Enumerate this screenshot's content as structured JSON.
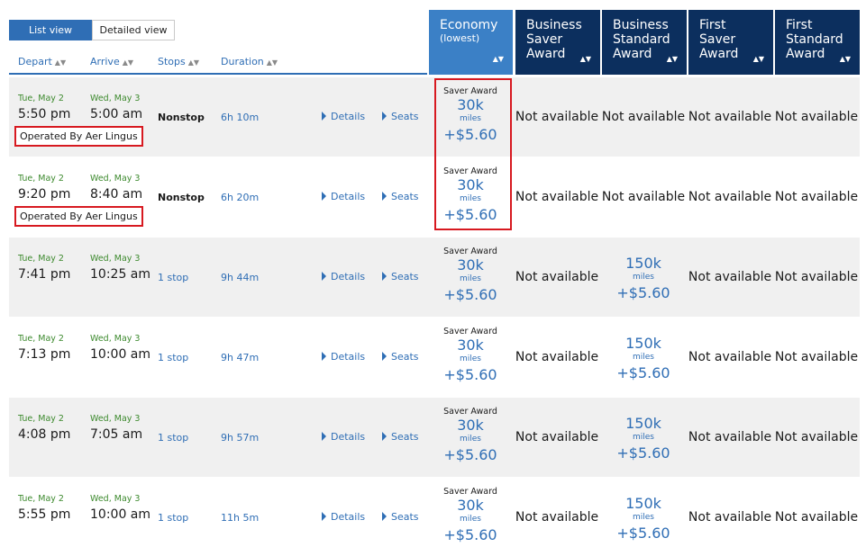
{
  "view_toggle": {
    "list": "List view",
    "detailed": "Detailed view"
  },
  "columns": {
    "depart": "Depart",
    "arrive": "Arrive",
    "stops": "Stops",
    "duration": "Duration"
  },
  "fare_headers": [
    {
      "title": "Economy",
      "sub": "(lowest)"
    },
    {
      "title": "Business Saver Award",
      "sub": ""
    },
    {
      "title": "Business Standard Award",
      "sub": ""
    },
    {
      "title": "First Saver Award",
      "sub": ""
    },
    {
      "title": "First Standard Award",
      "sub": ""
    }
  ],
  "sort_icon": "sort-arrows-icon",
  "colors": {
    "economy_header": "#3b80c6",
    "premium_header": "#0c2f5e",
    "link": "#2f6eb5",
    "date_green": "#3d8a2e",
    "highlight_red": "#d71920",
    "row_shade": "#f0f0f0"
  },
  "common": {
    "details": "Details",
    "seats": "Seats",
    "not_available": "Not available",
    "saver_award": "Saver Award",
    "miles_unit": "miles"
  },
  "flights": [
    {
      "dep_date": "Tue, May 2",
      "dep_time": "5:50 pm",
      "arr_date": "Wed, May 3",
      "arr_time": "5:00 am",
      "stops": "Nonstop",
      "duration": "6h 10m",
      "operated": "Operated By Aer Lingus",
      "econ_miles": "30k",
      "econ_tax": "+$5.60",
      "bus_std_miles": "",
      "bus_std_tax": ""
    },
    {
      "dep_date": "Tue, May 2",
      "dep_time": "9:20 pm",
      "arr_date": "Wed, May 3",
      "arr_time": "8:40 am",
      "stops": "Nonstop",
      "duration": "6h 20m",
      "operated": "Operated By Aer Lingus",
      "econ_miles": "30k",
      "econ_tax": "+$5.60",
      "bus_std_miles": "",
      "bus_std_tax": ""
    },
    {
      "dep_date": "Tue, May 2",
      "dep_time": "7:41 pm",
      "arr_date": "Wed, May 3",
      "arr_time": "10:25 am",
      "stops": "1 stop",
      "duration": "9h 44m",
      "operated": "",
      "econ_miles": "30k",
      "econ_tax": "+$5.60",
      "bus_std_miles": "150k",
      "bus_std_tax": "+$5.60"
    },
    {
      "dep_date": "Tue, May 2",
      "dep_time": "7:13 pm",
      "arr_date": "Wed, May 3",
      "arr_time": "10:00 am",
      "stops": "1 stop",
      "duration": "9h 47m",
      "operated": "",
      "econ_miles": "30k",
      "econ_tax": "+$5.60",
      "bus_std_miles": "150k",
      "bus_std_tax": "+$5.60"
    },
    {
      "dep_date": "Tue, May 2",
      "dep_time": "4:08 pm",
      "arr_date": "Wed, May 3",
      "arr_time": "7:05 am",
      "stops": "1 stop",
      "duration": "9h 57m",
      "operated": "",
      "econ_miles": "30k",
      "econ_tax": "+$5.60",
      "bus_std_miles": "150k",
      "bus_std_tax": "+$5.60"
    },
    {
      "dep_date": "Tue, May 2",
      "dep_time": "5:55 pm",
      "arr_date": "Wed, May 3",
      "arr_time": "10:00 am",
      "stops": "1 stop",
      "duration": "11h 5m",
      "operated": "",
      "econ_miles": "30k",
      "econ_tax": "+$5.60",
      "bus_std_miles": "150k",
      "bus_std_tax": "+$5.60"
    }
  ]
}
